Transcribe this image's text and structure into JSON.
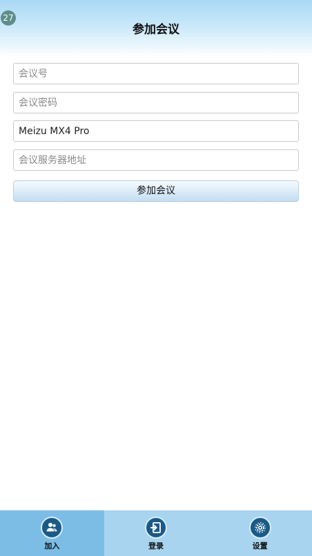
{
  "status": {
    "badge": "27"
  },
  "header": {
    "title": "参加会议"
  },
  "form": {
    "meeting_id_placeholder": "会议号",
    "meeting_password_placeholder": "会议密码",
    "display_name_value": "Meizu MX4 Pro",
    "server_address_placeholder": "会议服务器地址",
    "join_button_label": "参加会议"
  },
  "tabs": [
    {
      "label": "加入",
      "icon": "users-icon",
      "active": true
    },
    {
      "label": "登录",
      "icon": "login-icon",
      "active": false
    },
    {
      "label": "设置",
      "icon": "gear-icon",
      "active": false
    }
  ],
  "colors": {
    "header_top": "#a9d8f5",
    "tabbar": "#a8d4ef",
    "tab_active": "#7cbde6",
    "icon_circle": "#1b5a86",
    "badge": "#5e8e8a"
  }
}
